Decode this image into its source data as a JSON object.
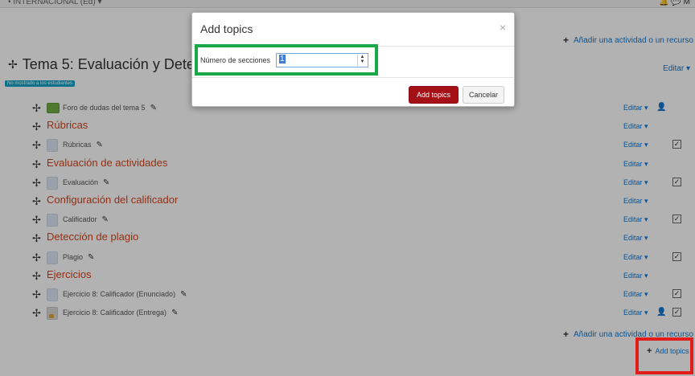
{
  "topbar": {
    "left_text": "• INTERNACIONAL (Ed) ▾",
    "right_text": "🔔 💬 M"
  },
  "add_activity_label": "Añadir una actividad o un recurso",
  "section": {
    "title": "Tema 5: Evaluación y Dete",
    "badge": "No mostrado a los estudiantes",
    "edit_label": "Editar ▾"
  },
  "rows": [
    {
      "kind": "activity",
      "icon": "forum-icon",
      "name": "Foro de dudas del tema 5",
      "edit": "Editar ▾",
      "person": true,
      "check": false
    },
    {
      "kind": "heading",
      "name": "Rúbricas",
      "edit": "Editar ▾"
    },
    {
      "kind": "activity",
      "icon": "file-icon",
      "name": "Rúbricas",
      "edit": "Editar ▾",
      "person": false,
      "check": true
    },
    {
      "kind": "heading",
      "name": "Evaluación de actividades",
      "edit": "Editar ▾"
    },
    {
      "kind": "activity",
      "icon": "file-icon",
      "name": "Evaluación",
      "edit": "Editar ▾",
      "person": false,
      "check": true
    },
    {
      "kind": "heading",
      "name": "Configuración del calificador",
      "edit": "Editar ▾"
    },
    {
      "kind": "activity",
      "icon": "file-icon",
      "name": "Calificador",
      "edit": "Editar ▾",
      "person": false,
      "check": true
    },
    {
      "kind": "heading",
      "name": "Detección de plagio",
      "edit": "Editar ▾"
    },
    {
      "kind": "activity",
      "icon": "file-icon",
      "name": "Plagio",
      "edit": "Editar ▾",
      "person": false,
      "check": true
    },
    {
      "kind": "heading",
      "name": "Ejercicios",
      "edit": "Editar ▾"
    },
    {
      "kind": "activity",
      "icon": "file-icon",
      "name": "Ejercicio 8: Calificador (Enunciado)",
      "edit": "Editar ▾",
      "person": false,
      "check": true
    },
    {
      "kind": "activity",
      "icon": "assignment-icon",
      "name": "Ejercicio 8: Calificador (Entrega)",
      "edit": "Editar ▾",
      "person": true,
      "check": true
    }
  ],
  "add_topics_label": "Add topics",
  "modal": {
    "title": "Add topics",
    "close_glyph": "×",
    "field_label": "Número de secciones",
    "field_value": "1",
    "primary_button": "Add topics",
    "cancel_button": "Cancelar"
  },
  "glyphs": {
    "move": "✢",
    "pencil": "✎",
    "person": "👤",
    "check": "✓",
    "plus": "+",
    "spin_up": "▲",
    "spin_down": "▼"
  },
  "colors": {
    "link": "#1177d1",
    "heading": "#d2451e",
    "primary_button": "#a50f16",
    "highlight_green": "#1ba84a",
    "highlight_red": "#e21b1b",
    "badge": "#13a5c9"
  }
}
